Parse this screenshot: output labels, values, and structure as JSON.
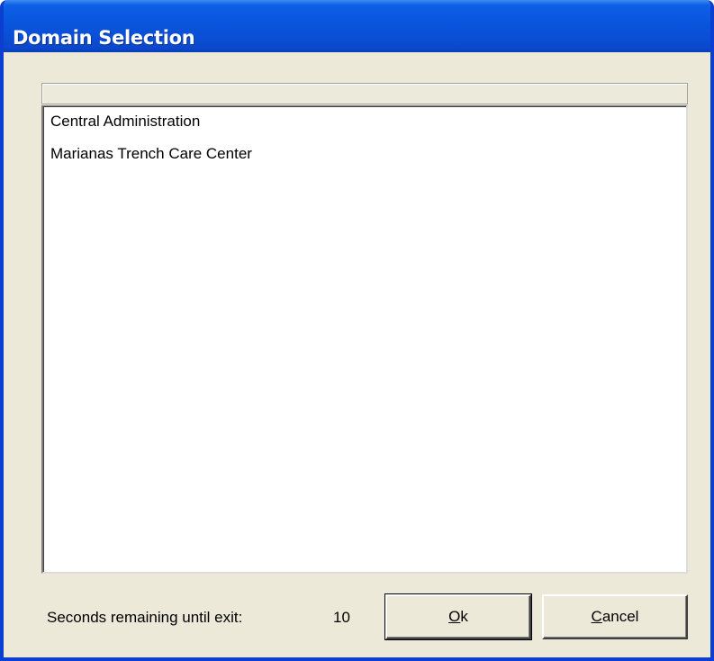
{
  "window": {
    "title": "Domain Selection"
  },
  "domain_list": {
    "items": [
      "Central Administration",
      "Marianas Trench Care Center"
    ]
  },
  "status": {
    "label": "Seconds remaining until exit:",
    "seconds": "10"
  },
  "buttons": {
    "ok": {
      "mnemonic": "O",
      "rest": "k"
    },
    "cancel": {
      "mnemonic": "C",
      "rest": "ancel"
    }
  },
  "colors": {
    "titlebar": "#0a55dd",
    "face": "#ece9d8"
  }
}
